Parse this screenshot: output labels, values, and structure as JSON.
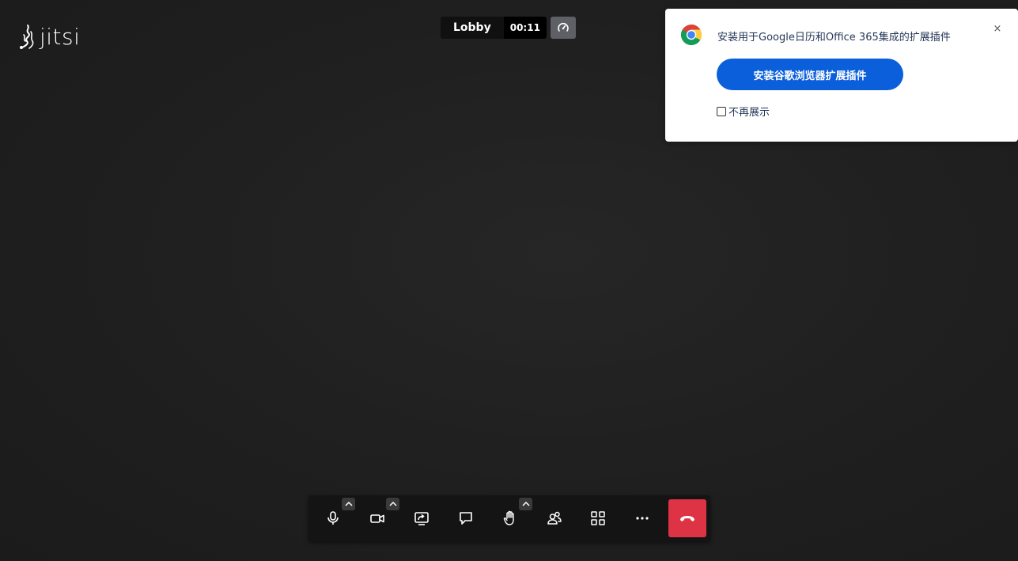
{
  "logo": {
    "text": "jitsi",
    "icon": "jitsi-logo-icon"
  },
  "conference": {
    "subject": "Lobby",
    "timer": "00:11",
    "connection_icon": "speedometer-icon"
  },
  "notification": {
    "icon": "chrome-icon",
    "title": "安装用于Google日历和Office 365集成的扩展插件",
    "close_label": "×",
    "button_label": "安装谷歌浏览器扩展插件",
    "checkbox_label": "不再展示",
    "checkbox_checked": false,
    "button_color": "#0b5fdb"
  },
  "toolbar": {
    "buttons": [
      {
        "name": "microphone",
        "icon": "microphone-icon",
        "has_options": true
      },
      {
        "name": "camera",
        "icon": "camera-icon",
        "has_options": true
      },
      {
        "name": "share-screen",
        "icon": "share-screen-icon",
        "has_options": false
      },
      {
        "name": "chat",
        "icon": "chat-icon",
        "has_options": false
      },
      {
        "name": "raise-hand",
        "icon": "raise-hand-icon",
        "has_options": true
      },
      {
        "name": "participants",
        "icon": "participants-icon",
        "has_options": false
      },
      {
        "name": "tile-view",
        "icon": "tile-view-icon",
        "has_options": false
      },
      {
        "name": "more",
        "icon": "more-icon",
        "has_options": false
      },
      {
        "name": "hangup",
        "icon": "hangup-icon",
        "has_options": false
      }
    ],
    "hangup_color": "#dd3344"
  }
}
